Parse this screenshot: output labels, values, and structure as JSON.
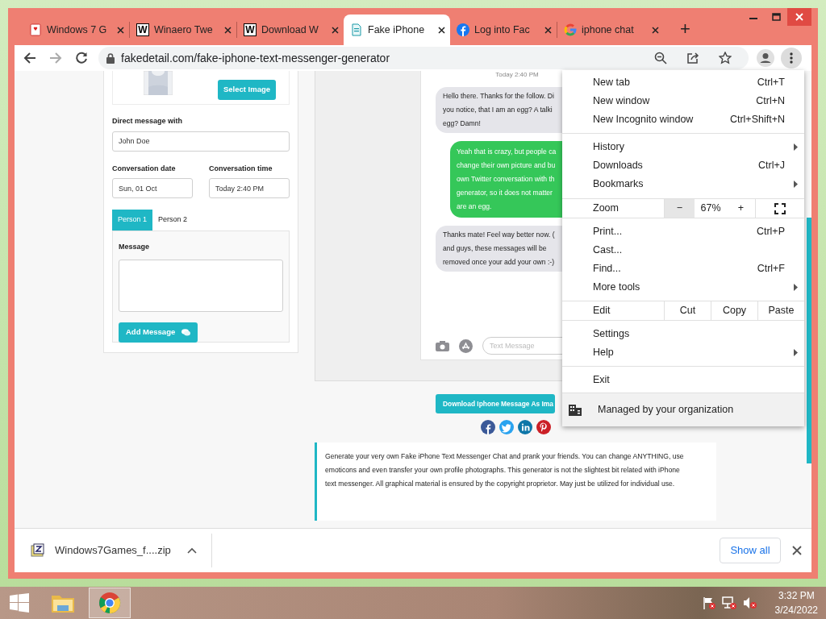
{
  "tabs": [
    {
      "title": "Windows 7 G",
      "kind": "cards",
      "selected": false
    },
    {
      "title": "Winaero Twe",
      "kind": "letter",
      "favicon_letter": "W",
      "selected": false
    },
    {
      "title": "Download W",
      "kind": "letter",
      "favicon_letter": "W",
      "selected": false
    },
    {
      "title": "Fake iPhone",
      "kind": "document",
      "selected": true
    },
    {
      "title": "Log into Fac",
      "kind": "facebook",
      "selected": false
    },
    {
      "title": "iphone chat",
      "kind": "google",
      "selected": false
    }
  ],
  "new_tab_button": "+",
  "address_bar": {
    "url": "fakedetail.com/fake-iphone-text-messenger-generator"
  },
  "form": {
    "select_image_button": "Select Image",
    "direct_message_label": "Direct message with",
    "direct_message_value": "John Doe",
    "date_label": "Conversation date",
    "date_value": "Sun, 01 Oct",
    "time_label": "Conversation time",
    "time_value": "Today 2:40 PM",
    "person_tabs": [
      {
        "label": "Person 1",
        "selected": true
      },
      {
        "label": "Person 2",
        "selected": false
      }
    ],
    "message_label": "Message",
    "add_message_button": "Add Message"
  },
  "chat": {
    "timestamp": "Today 2:40 PM",
    "messages": [
      {
        "kind": "received",
        "lines": [
          "Hello there. Thanks for the follow. Di",
          "you notice, that I am an egg? A talki",
          "egg? Damn!"
        ]
      },
      {
        "kind": "sent",
        "lines": [
          "Yeah that is crazy, but people ca",
          "change their own picture and bu",
          "own Twitter conversation with th",
          "generator, so it does not matter",
          "are an egg."
        ]
      },
      {
        "kind": "received",
        "lines": [
          "Thanks mate! Feel way better now. (",
          "and guys, these messages will be",
          "removed once your add your own :-)"
        ]
      }
    ],
    "input_placeholder": "Text Message"
  },
  "download_image_button": "Download Iphone Message As Ima",
  "share_icons": [
    {
      "kind": "facebook"
    },
    {
      "kind": "twitter"
    },
    {
      "kind": "linkedin"
    },
    {
      "kind": "pinterest"
    }
  ],
  "description": "Generate your very own Fake iPhone Text Messenger Chat and prank your friends. You can change ANYTHING, use emoticons and even transfer your own profile photographs. This generator is not the slightest bit related with iPhone text messenger. All graphical material is ensured by the copyright proprietor. May just be utilized for individual use.",
  "menu": {
    "groups": [
      {
        "kind": "items",
        "items": [
          {
            "label": "New tab",
            "shortcut": "Ctrl+T",
            "submenu": false
          },
          {
            "label": "New window",
            "shortcut": "Ctrl+N",
            "submenu": false
          },
          {
            "label": "New Incognito window",
            "shortcut": "Ctrl+Shift+N",
            "submenu": false
          }
        ]
      },
      {
        "kind": "items",
        "items": [
          {
            "label": "History",
            "submenu": true
          },
          {
            "label": "Downloads",
            "shortcut": "Ctrl+J",
            "submenu": false
          },
          {
            "label": "Bookmarks",
            "submenu": true
          }
        ]
      },
      {
        "kind": "zoom",
        "label": "Zoom",
        "minus": "−",
        "value": "67%",
        "plus": "+"
      },
      {
        "kind": "items",
        "items": [
          {
            "label": "Print...",
            "shortcut": "Ctrl+P",
            "submenu": false
          },
          {
            "label": "Cast...",
            "submenu": false
          },
          {
            "label": "Find...",
            "shortcut": "Ctrl+F",
            "submenu": false
          },
          {
            "label": "More tools",
            "submenu": true
          }
        ]
      },
      {
        "kind": "edit",
        "label": "Edit",
        "actions": [
          "Cut",
          "Copy",
          "Paste"
        ]
      },
      {
        "kind": "items",
        "items": [
          {
            "label": "Settings",
            "submenu": false
          },
          {
            "label": "Help",
            "submenu": true
          }
        ]
      },
      {
        "kind": "items",
        "items": [
          {
            "label": "Exit",
            "submenu": false
          }
        ]
      },
      {
        "kind": "managed",
        "label": "Managed by your organization"
      }
    ]
  },
  "downloads_bar": {
    "file": "Windows7Games_f....zip",
    "show_all": "Show all"
  },
  "taskbar": {
    "apps": [
      {
        "kind": "explorer",
        "selected": false
      },
      {
        "kind": "chrome",
        "selected": true
      }
    ],
    "time": "3:32 PM",
    "date": "3/24/2022"
  }
}
